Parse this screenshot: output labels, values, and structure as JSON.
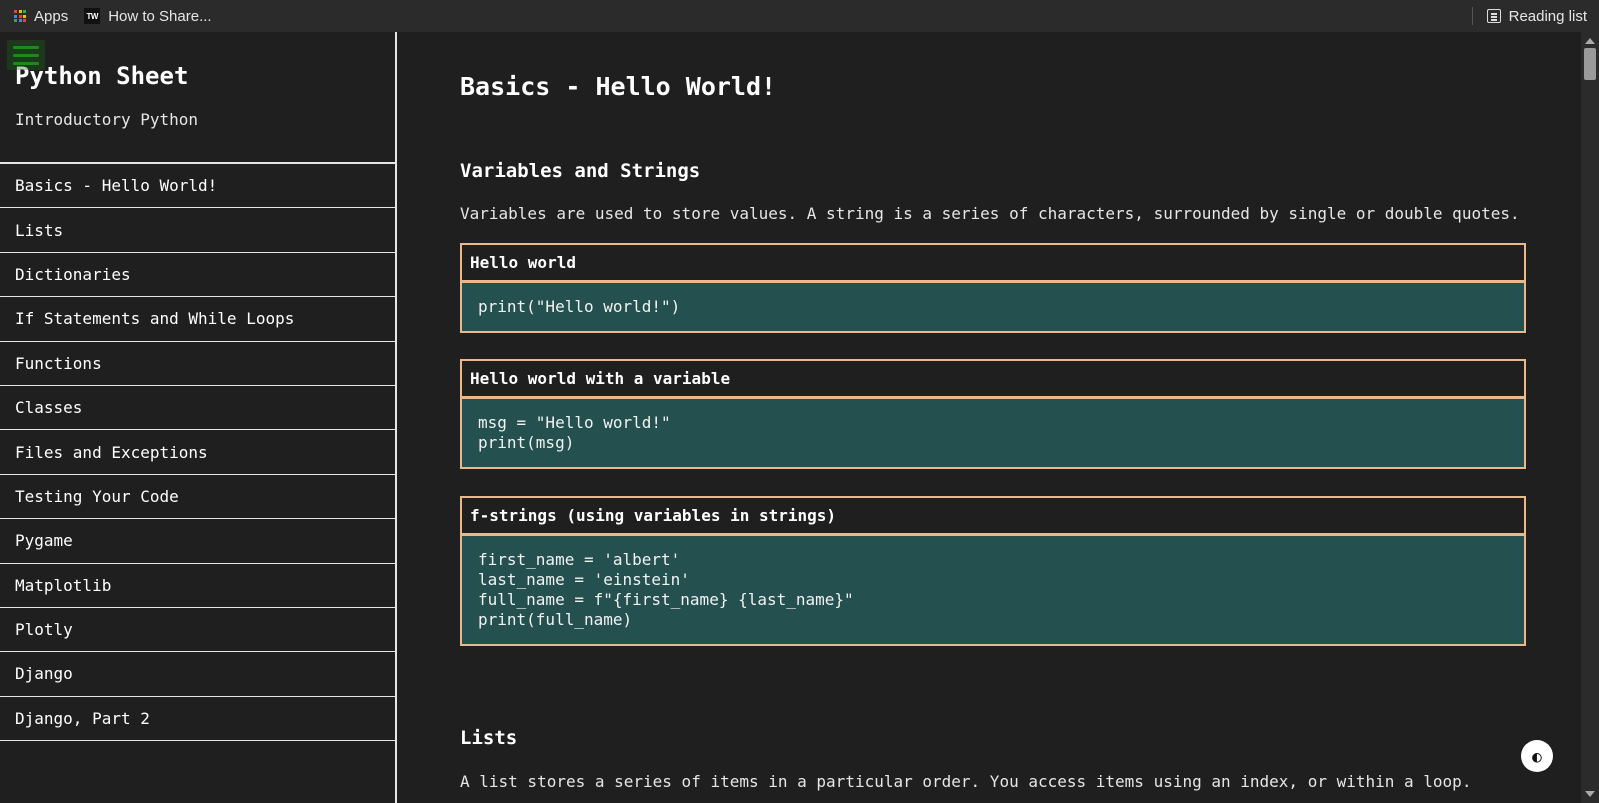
{
  "bookmarks": {
    "apps_label": "Apps",
    "share_label": "How to Share...",
    "share_icon_text": "TW",
    "reading_list_label": "Reading list"
  },
  "sidebar": {
    "title": "Python Sheet",
    "subtitle": "Introductory Python",
    "items": [
      {
        "label": "Basics - Hello World!"
      },
      {
        "label": "Lists"
      },
      {
        "label": "Dictionaries"
      },
      {
        "label": "If Statements and While Loops"
      },
      {
        "label": "Functions"
      },
      {
        "label": "Classes"
      },
      {
        "label": "Files and Exceptions"
      },
      {
        "label": "Testing Your Code"
      },
      {
        "label": "Pygame"
      },
      {
        "label": "Matplotlib"
      },
      {
        "label": "Plotly"
      },
      {
        "label": "Django"
      },
      {
        "label": "Django, Part 2"
      }
    ]
  },
  "main": {
    "page_title": "Basics - Hello World!",
    "sections": [
      {
        "title": "Variables and Strings",
        "text": "Variables are used to store values. A string is a series of characters, surrounded by single or double quotes.",
        "cards": [
          {
            "header": "Hello world",
            "code": "print(\"Hello world!\")"
          },
          {
            "header": "Hello world with a variable",
            "code": "msg = \"Hello world!\"\nprint(msg)"
          },
          {
            "header": "f-strings (using variables in strings)",
            "code": "first_name = 'albert'\nlast_name = 'einstein'\nfull_name = f\"{first_name} {last_name}\"\nprint(full_name)"
          }
        ]
      },
      {
        "title": "Lists",
        "text": "A list stores a series of items in a particular order. You access items using an index, or within a loop."
      }
    ]
  },
  "colors": {
    "background": "#1f1f1f",
    "code_bg": "#245050",
    "card_border": "#e8b98a",
    "hamburger": "#1a8a1a"
  },
  "icons": {
    "apps": "apps-grid-icon",
    "share": "tw-favicon-icon",
    "reading_list": "reading-list-icon",
    "menu": "hamburger-menu-icon",
    "theme": "contrast-icon"
  }
}
